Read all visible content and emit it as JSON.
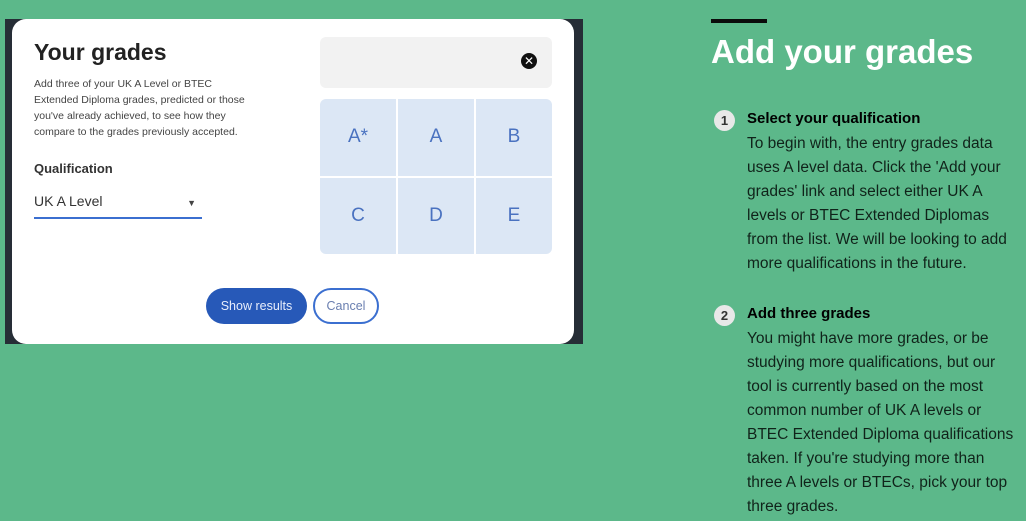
{
  "modal": {
    "title": "Your grades",
    "description": "Add three of your UK A Level or BTEC Extended Diploma grades, predicted or those you've already achieved, to see how they compare to the grades previously accepted.",
    "qualification_label": "Qualification",
    "qualification_value": "UK A Level",
    "grades": [
      "A*",
      "A",
      "B",
      "C",
      "D",
      "E"
    ],
    "show_results": "Show results",
    "cancel": "Cancel"
  },
  "panel": {
    "title": "Add your grades",
    "steps": [
      {
        "num": "1",
        "title": "Select your qualification",
        "text": "To begin with, the entry grades data uses A level data. Click the 'Add your grades' link and select either UK A levels or BTEC Extended Diplomas from the list. We will be looking to add more qualifications in the future."
      },
      {
        "num": "2",
        "title": "Add three grades",
        "text": "You might have more grades, or be studying more qualifications, but our tool is currently based on the most common number of UK A levels or BTEC Extended Diploma qualifications taken. If you're studying more than three A levels or BTECs, pick your top three grades."
      }
    ]
  },
  "colors": {
    "background": "#5cb88a",
    "primary": "#2759b8",
    "grade_tile": "#dce7f5"
  }
}
